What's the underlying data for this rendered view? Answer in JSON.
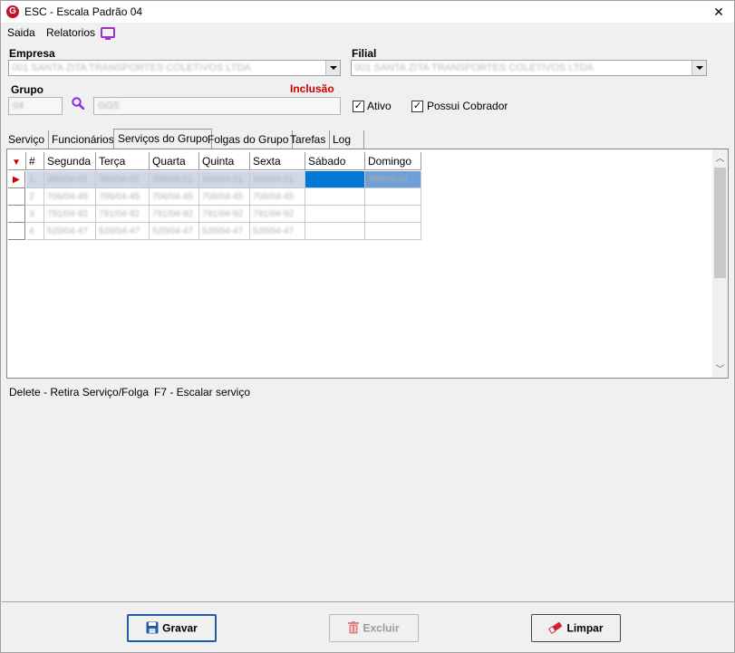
{
  "window": {
    "title": "ESC - Escala Padrão 04",
    "app_icon_letter": "G",
    "close_glyph": "✕"
  },
  "menu": {
    "items": [
      "Saida",
      "Relatorios"
    ],
    "screen_icon": "monitor-icon"
  },
  "form": {
    "empresa_label": "Empresa",
    "empresa_value": "001 SANTA ZITA TRANSPORTES COLETIVOS LTDA",
    "filial_label": "Filial",
    "filial_value": "001 SANTA ZITA TRANSPORTES COLETIVOS LTDA",
    "grupo_label": "Grupo",
    "grupo_code": "04",
    "grupo_desc": "GG5",
    "mode_label": "Inclusão",
    "mode_color": "#d00000",
    "ativo_label": "Ativo",
    "ativo_checked": true,
    "cobrador_label": "Possui Cobrador",
    "cobrador_checked": true
  },
  "tabs": {
    "items": [
      "Serviço",
      "Funcionários",
      "Serviços do Grupo",
      "Folgas do Grupo",
      "Tarefas",
      "Log"
    ],
    "active": "Serviços do Grupo"
  },
  "grid": {
    "columns": [
      "#",
      "Segunda",
      "Terça",
      "Quarta",
      "Quinta",
      "Sexta",
      "Sábado",
      "Domingo"
    ],
    "rows": [
      [
        "1",
        "396/04-01",
        "396/04-01",
        "396/04-01",
        "396/04-01",
        "396/04-01",
        "",
        "396/04-01"
      ],
      [
        "2",
        "706/04-45",
        "706/04-45",
        "706/04-45",
        "706/04-45",
        "706/04-45",
        "",
        ""
      ],
      [
        "3",
        "791/04-92",
        "791/04-92",
        "791/04-92",
        "791/04-92",
        "791/04-92",
        "",
        ""
      ],
      [
        "4",
        "520/04-47",
        "520/04-47",
        "520/04-47",
        "520/04-47",
        "520/04-47",
        "",
        ""
      ]
    ],
    "current_row_marker": "▶",
    "header_marker": "▼"
  },
  "hints": {
    "delete_hint": "Delete - Retira Serviço/Folga",
    "f7_hint": "F7 - Escalar serviço"
  },
  "buttons": {
    "save_label": "Gravar",
    "delete_label": "Excluir",
    "clear_label": "Limpar"
  },
  "colors": {
    "accent": "#0078d7",
    "brand": "#c3102f",
    "search_icon": "#8a2be2"
  }
}
